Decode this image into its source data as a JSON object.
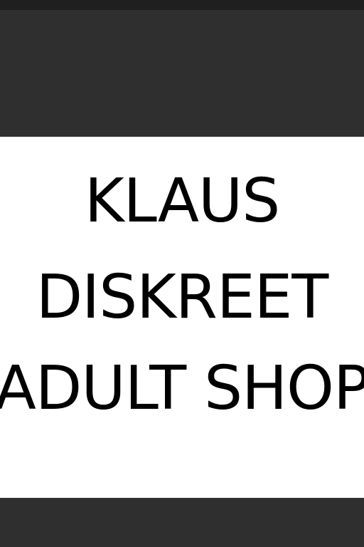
{
  "sign": {
    "lines": [
      "KLAUS",
      "DISKREET",
      "ADULT SHOP"
    ]
  },
  "colors": {
    "background": "#2f2f2f",
    "top_strip": "#1f1f1f",
    "panel": "#ffffff",
    "text": "#000000"
  }
}
